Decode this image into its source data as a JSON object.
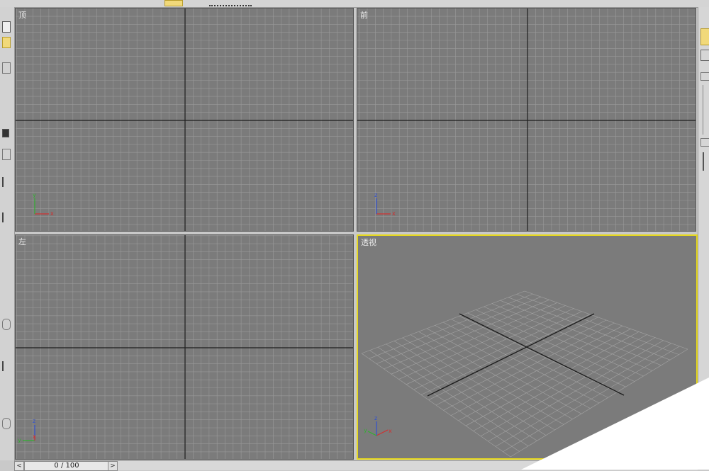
{
  "viewports": {
    "top": {
      "label": "顶"
    },
    "front": {
      "label": "前"
    },
    "left": {
      "label": "左"
    },
    "perspective": {
      "label": "透视"
    }
  },
  "axes": {
    "x": "x",
    "y": "y",
    "z": "z"
  },
  "timeline": {
    "frame_text": "0 / 100",
    "prev_arrow": "<",
    "next_arrow": ">"
  },
  "colors": {
    "viewport_bg": "#7b7b7b",
    "grid_minor": "#9a9a9a",
    "grid_major": "#1e1e1e",
    "active_border": "#e6d81e",
    "x_axis": "#d03030",
    "y_axis": "#30b030",
    "z_axis": "#3050d0"
  }
}
